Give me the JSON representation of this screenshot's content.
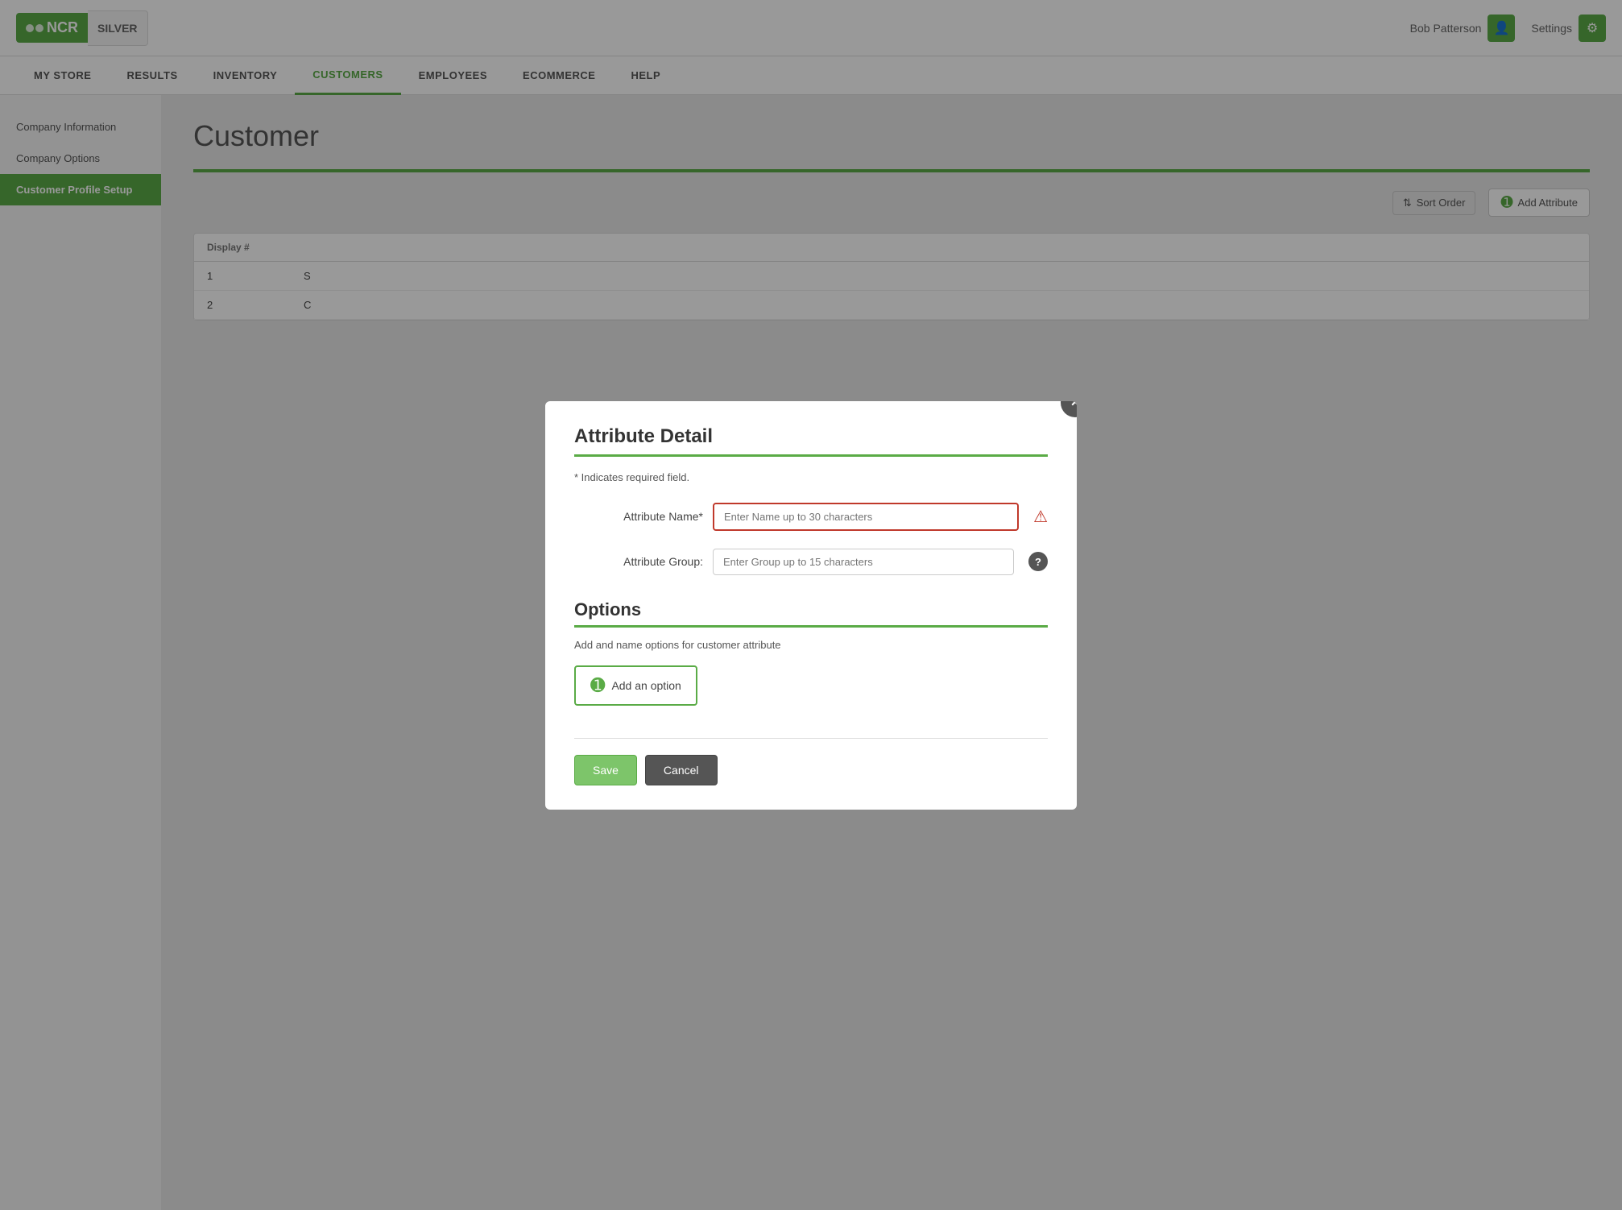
{
  "topbar": {
    "logo_ncr": "NCR",
    "logo_silver": "SILVER",
    "username": "Bob Patterson",
    "settings_label": "Settings"
  },
  "nav": {
    "items": [
      {
        "id": "my-store",
        "label": "MY STORE"
      },
      {
        "id": "results",
        "label": "RESULTS"
      },
      {
        "id": "inventory",
        "label": "INVENTORY"
      },
      {
        "id": "customers",
        "label": "CUSTOMERS",
        "active": true
      },
      {
        "id": "employees",
        "label": "EMPLOYEES"
      },
      {
        "id": "ecommerce",
        "label": "ECOMMERCE"
      },
      {
        "id": "help",
        "label": "HELP"
      }
    ]
  },
  "sidebar": {
    "items": [
      {
        "id": "company-information",
        "label": "Company Information"
      },
      {
        "id": "company-options",
        "label": "Company Options"
      },
      {
        "id": "customer-profile-setup",
        "label": "Customer Profile Setup",
        "active": true
      }
    ]
  },
  "main": {
    "page_title": "Customer",
    "toolbar": {
      "sort_order": "Sort Order",
      "add_attribute": "Add Attribute"
    },
    "table": {
      "columns": [
        "Display #",
        ""
      ],
      "rows": [
        {
          "display": "1",
          "name": "S"
        },
        {
          "display": "2",
          "name": "C"
        }
      ]
    }
  },
  "modal": {
    "title": "Attribute Detail",
    "required_note": "* Indicates required field.",
    "close_label": "×",
    "form": {
      "name_label": "Attribute Name*",
      "name_placeholder": "Enter Name up to 30 characters",
      "group_label": "Attribute Group:",
      "group_placeholder": "Enter Group up to 15 characters"
    },
    "options": {
      "title": "Options",
      "description": "Add and name options for customer attribute",
      "add_option_label": "Add an option"
    },
    "footer": {
      "save_label": "Save",
      "cancel_label": "Cancel"
    }
  }
}
